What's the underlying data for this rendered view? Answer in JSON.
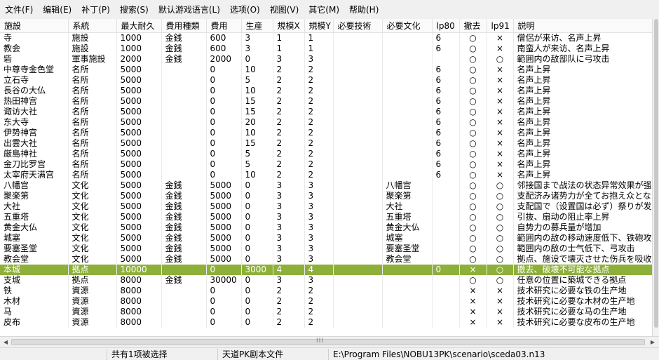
{
  "menu": [
    "文件(F)",
    "编辑(E)",
    "补丁(P)",
    "搜索(S)",
    "默认游戏语言(L)",
    "选项(O)",
    "视图(V)",
    "其它(M)",
    "帮助(H)"
  ],
  "columns": [
    "施設",
    "系統",
    "最大耐久",
    "費用種類",
    "費用",
    "生産",
    "規模X",
    "規模Y",
    "必要技術",
    "必要文化",
    "lp80",
    "撤去",
    "lp91",
    "説明"
  ],
  "rows": [
    [
      "寺",
      "施設",
      "1000",
      "金銭",
      "600",
      "3",
      "1",
      "1",
      "",
      "",
      "6",
      "○",
      "×",
      "僧侶が来访、名声上昇"
    ],
    [
      "教会",
      "施設",
      "1000",
      "金銭",
      "600",
      "3",
      "1",
      "1",
      "",
      "",
      "6",
      "○",
      "×",
      "南蛮人が来访、名声上昇"
    ],
    [
      "砦",
      "軍事施設",
      "2000",
      "金銭",
      "2000",
      "0",
      "3",
      "3",
      "",
      "",
      "",
      "○",
      "○",
      "範囲内の敌部队に弓攻击"
    ],
    [
      "中尊寺金色堂",
      "名所",
      "5000",
      "",
      "0",
      "10",
      "2",
      "2",
      "",
      "",
      "6",
      "○",
      "×",
      "名声上昇"
    ],
    [
      "立石寺",
      "名所",
      "5000",
      "",
      "0",
      "5",
      "2",
      "2",
      "",
      "",
      "6",
      "○",
      "×",
      "名声上昇"
    ],
    [
      "長谷の大仏",
      "名所",
      "5000",
      "",
      "0",
      "10",
      "2",
      "2",
      "",
      "",
      "6",
      "○",
      "×",
      "名声上昇"
    ],
    [
      "热田神宫",
      "名所",
      "5000",
      "",
      "0",
      "15",
      "2",
      "2",
      "",
      "",
      "6",
      "○",
      "×",
      "名声上昇"
    ],
    [
      "诹访大社",
      "名所",
      "5000",
      "",
      "0",
      "15",
      "2",
      "2",
      "",
      "",
      "6",
      "○",
      "×",
      "名声上昇"
    ],
    [
      "东大寺",
      "名所",
      "5000",
      "",
      "0",
      "20",
      "2",
      "2",
      "",
      "",
      "6",
      "○",
      "×",
      "名声上昇"
    ],
    [
      "伊势神宫",
      "名所",
      "5000",
      "",
      "0",
      "10",
      "2",
      "2",
      "",
      "",
      "6",
      "○",
      "×",
      "名声上昇"
    ],
    [
      "出雲大社",
      "名所",
      "5000",
      "",
      "0",
      "15",
      "2",
      "2",
      "",
      "",
      "6",
      "○",
      "×",
      "名声上昇"
    ],
    [
      "厳島神社",
      "名所",
      "5000",
      "",
      "0",
      "5",
      "2",
      "2",
      "",
      "",
      "6",
      "○",
      "×",
      "名声上昇"
    ],
    [
      "金刀比罗宫",
      "名所",
      "5000",
      "",
      "0",
      "5",
      "2",
      "2",
      "",
      "",
      "6",
      "○",
      "×",
      "名声上昇"
    ],
    [
      "太宰府天满宫",
      "名所",
      "5000",
      "",
      "0",
      "10",
      "2",
      "2",
      "",
      "",
      "6",
      "○",
      "×",
      "名声上昇"
    ],
    [
      "八幡宫",
      "文化",
      "5000",
      "金銭",
      "5000",
      "0",
      "3",
      "3",
      "",
      "八幡宫",
      "",
      "○",
      "○",
      "邻接国まで战法の状态异常效果が强"
    ],
    [
      "聚楽第",
      "文化",
      "5000",
      "金銭",
      "5000",
      "0",
      "3",
      "3",
      "",
      "聚楽第",
      "",
      "○",
      "○",
      "支配济み诸势力が全てお抱え众とな"
    ],
    [
      "大社",
      "文化",
      "5000",
      "金銭",
      "5000",
      "0",
      "3",
      "3",
      "",
      "大社",
      "",
      "○",
      "○",
      "支配国で（设置国は必ず）祭りが发"
    ],
    [
      "五重塔",
      "文化",
      "5000",
      "金銭",
      "5000",
      "0",
      "3",
      "3",
      "",
      "五重塔",
      "",
      "○",
      "○",
      "引抜、扇动の阻止率上昇"
    ],
    [
      "黄金大仏",
      "文化",
      "5000",
      "金銭",
      "5000",
      "0",
      "3",
      "3",
      "",
      "黄金大仏",
      "",
      "○",
      "○",
      "自势力の募兵量が增加"
    ],
    [
      "城塞",
      "文化",
      "5000",
      "金銭",
      "5000",
      "0",
      "3",
      "3",
      "",
      "城塞",
      "",
      "○",
      "○",
      "範囲内の敌の移动速度低下、铁砲攻"
    ],
    [
      "要塞圣堂",
      "文化",
      "5000",
      "金銭",
      "5000",
      "0",
      "3",
      "3",
      "",
      "要塞圣堂",
      "",
      "○",
      "○",
      "範囲内の敌の士气低下、弓攻击"
    ],
    [
      "教会堂",
      "文化",
      "5000",
      "金銭",
      "5000",
      "0",
      "3",
      "3",
      "",
      "教会堂",
      "",
      "○",
      "○",
      "拠点、施设で壊灭させた伤兵を吸收"
    ],
    [
      "本城",
      "拠点",
      "10000",
      "",
      "0",
      "3000",
      "4",
      "4",
      "",
      "",
      "0",
      "×",
      "○",
      "撤去、破壊不可能な拠点"
    ],
    [
      "支城",
      "拠点",
      "8000",
      "金銭",
      "30000",
      "0",
      "3",
      "3",
      "",
      "",
      "",
      "○",
      "○",
      "任意の位置に築城できる拠点"
    ],
    [
      "铁",
      "資源",
      "8000",
      "",
      "0",
      "0",
      "2",
      "2",
      "",
      "",
      "",
      "×",
      "×",
      "技术研究に必要な铁の生产地"
    ],
    [
      "木材",
      "資源",
      "8000",
      "",
      "0",
      "0",
      "2",
      "2",
      "",
      "",
      "",
      "×",
      "×",
      "技术研究に必要な木材の生产地"
    ],
    [
      "马",
      "資源",
      "8000",
      "",
      "0",
      "0",
      "2",
      "2",
      "",
      "",
      "",
      "×",
      "×",
      "技术研究に必要な马の生产地"
    ],
    [
      "皮布",
      "資源",
      "8000",
      "",
      "0",
      "0",
      "2",
      "2",
      "",
      "",
      "",
      "×",
      "×",
      "技术研究に必要な皮布の生产地"
    ]
  ],
  "selected_row_index": 22,
  "colors": {
    "selection": "#8db03a",
    "selection_text": "#ffffff",
    "chrome": "#f0f0f0"
  },
  "scrollbar": {
    "grip": "III"
  },
  "status": {
    "selection": "共有1项被选择",
    "file_type": "天道PK剧本文件",
    "path": "E:\\Program Files\\NOBU13PK\\scenario\\sceda03.n13"
  }
}
